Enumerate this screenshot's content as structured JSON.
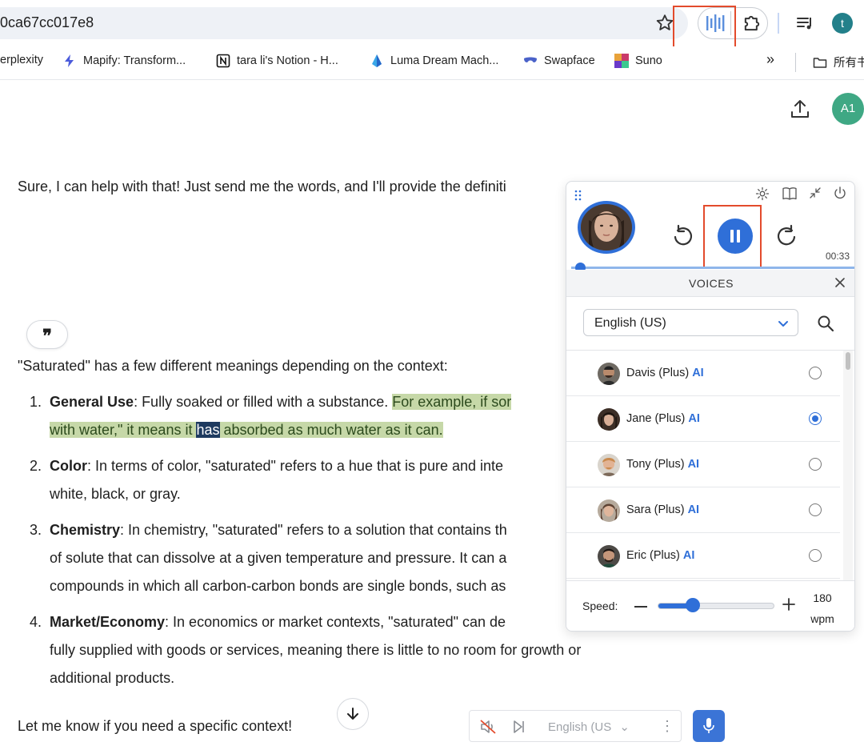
{
  "browser": {
    "url": "0ca67cc017e8",
    "profile_initial": "t",
    "bookmarks": [
      {
        "label": "erplexity"
      },
      {
        "label": "Mapify: Transform..."
      },
      {
        "label": "tara li's Notion - H..."
      },
      {
        "label": "Luma Dream Mach..."
      },
      {
        "label": "Swapface"
      },
      {
        "label": "Suno"
      }
    ],
    "bookmarks_overflow": "»",
    "folder_label": "所有书",
    "colors": {
      "annotation_red": "#e34b2c",
      "accent_blue": "#2f6fd8"
    }
  },
  "chat": {
    "avatar_label": "A1",
    "intro": "Sure, I can help with that! Just send me the words, and I'll provide the definiti",
    "quote_glyph": "❞",
    "lead": "\"Saturated\" has a few different meanings depending on the context:",
    "items": [
      {
        "num": "1.",
        "term": "General Use",
        "line1_text": ": Fully soaked or filled with a substance. ",
        "line1_hl": "For example, if sor",
        "line2_hl_a": "with water,\" it means it ",
        "line2_hl_word": "has",
        "line2_hl_b": " absorbed as much water as it can."
      },
      {
        "num": "2.",
        "term": "Color",
        "line1_text": ": In terms of color, \"saturated\" refers to a hue that is pure and inte",
        "line2": "white, black, or gray."
      },
      {
        "num": "3.",
        "term": "Chemistry",
        "line1_text": ": In chemistry, \"saturated\" refers to a solution that contains th",
        "line2": "of solute that can dissolve at a given temperature and pressure. It can a",
        "line3": "compounds in which all carbon-carbon bonds are single bonds, such as"
      },
      {
        "num": "4.",
        "term": "Market/Economy",
        "line1_text": ": In economics or market contexts, \"saturated\" can de",
        "line2": "fully supplied with goods or services, meaning there is little to no room for growth or",
        "line3": "additional products."
      }
    ],
    "closing": "Let me know if you need a specific context!",
    "mini_player": {
      "language": "English (US",
      "chevron": "⌄",
      "more": "⋮"
    }
  },
  "reader": {
    "elapsed": "00:33",
    "playback_progress": 0.03,
    "voices_title": "VOICES",
    "language": "English (US)",
    "voices": [
      {
        "name": "Davis (Plus)",
        "tag": "AI",
        "selected": false
      },
      {
        "name": "Jane (Plus)",
        "tag": "AI",
        "selected": true
      },
      {
        "name": "Tony (Plus)",
        "tag": "AI",
        "selected": false
      },
      {
        "name": "Sara (Plus)",
        "tag": "AI",
        "selected": false
      },
      {
        "name": "Eric (Plus)",
        "tag": "AI",
        "selected": false
      }
    ],
    "speed_label": "Speed:",
    "speed_value": "180",
    "speed_unit": "wpm",
    "speed_level": 0.3
  }
}
